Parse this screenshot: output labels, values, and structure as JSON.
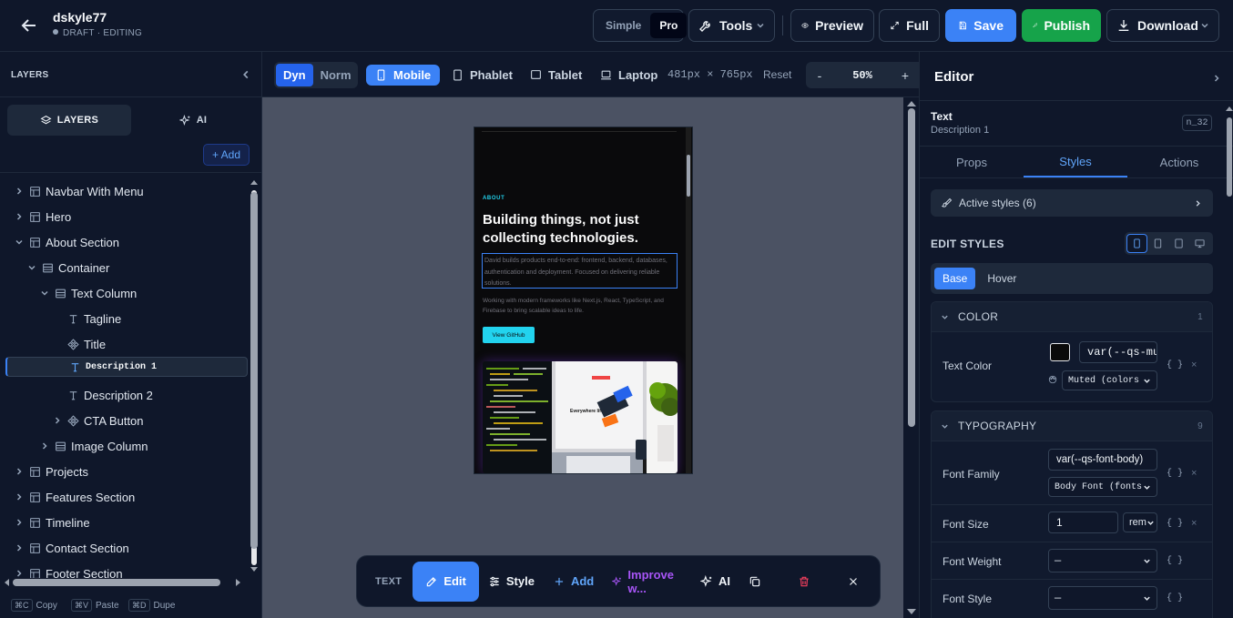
{
  "project": {
    "name": "dskyle77",
    "status": "DRAFT · EDITING"
  },
  "topbar": {
    "modes": [
      "Simple",
      "Pro"
    ],
    "tools_label": "Tools",
    "preview_label": "Preview",
    "full_label": "Full",
    "save_label": "Save",
    "publish_label": "Publish",
    "download_label": "Download"
  },
  "colors": {
    "accent": "#3b82f6",
    "publish": "#16a34a",
    "cyan": "#22d3ee",
    "danger": "#f43f5e"
  },
  "layers_panel": {
    "title": "LAYERS",
    "tabs": [
      "LAYERS",
      "AI"
    ],
    "add_label": "+ Add",
    "tree": [
      {
        "label": "Navbar With Menu",
        "icon": "layout-icon",
        "arrow": "right"
      },
      {
        "label": "Hero",
        "icon": "layout-icon",
        "arrow": "right"
      },
      {
        "label": "About Section",
        "icon": "layout-icon",
        "arrow": "down"
      },
      {
        "label": "Container",
        "icon": "box-icon",
        "arrow": "down"
      },
      {
        "label": "Text Column",
        "icon": "box-icon",
        "arrow": "down"
      },
      {
        "label": "Tagline",
        "icon": "text-icon",
        "arrow": ""
      },
      {
        "label": "Title",
        "icon": "component-icon",
        "arrow": ""
      },
      {
        "label": "Description 1",
        "icon": "text-icon",
        "arrow": "",
        "selected": true
      },
      {
        "label": "Description 2",
        "icon": "text-icon",
        "arrow": ""
      },
      {
        "label": "CTA Button",
        "icon": "component-icon",
        "arrow": "right"
      },
      {
        "label": "Image Column",
        "icon": "box-icon",
        "arrow": "right"
      },
      {
        "label": "Projects",
        "icon": "layout-icon",
        "arrow": "right"
      },
      {
        "label": "Features Section",
        "icon": "layout-icon",
        "arrow": "right"
      },
      {
        "label": "Timeline",
        "icon": "layout-icon",
        "arrow": "right"
      },
      {
        "label": "Contact Section",
        "icon": "layout-icon",
        "arrow": "right"
      },
      {
        "label": "Footer Section",
        "icon": "layout-icon",
        "arrow": "right"
      }
    ],
    "shortcuts": [
      {
        "key": "⌘C",
        "label": "Copy"
      },
      {
        "key": "⌘V",
        "label": "Paste"
      },
      {
        "key": "⌘D",
        "label": "Dupe"
      }
    ]
  },
  "canvas_toolbar": {
    "dyn": "Dyn",
    "norm": "Norm",
    "devices": [
      "Mobile",
      "Phablet",
      "Tablet",
      "Laptop"
    ],
    "dimensions": "481px × 765px",
    "reset": "Reset",
    "zoom_minus": "-",
    "zoom": "50%",
    "zoom_plus": "+"
  },
  "preview": {
    "tagline": "ABOUT",
    "title": "Building things, not just collecting technologies.",
    "description1": "David builds products end-to-end: frontend, backend, databases, authentication and deployment. Focused on delivering reliable solutions.",
    "description2": "Working with modern frameworks like Next.js, React, TypeScript, and Firebase to bring scalable ideas to life.",
    "cta": "View GitHub"
  },
  "floating_bar": {
    "type_label": "TEXT",
    "edit": "Edit",
    "style": "Style",
    "add": "Add",
    "improve": "Improve w...",
    "ai": "AI"
  },
  "editor": {
    "title": "Editor",
    "selected_type": "Text",
    "selected_name": "Description 1",
    "node_id": "n_32",
    "tabs": [
      "Props",
      "Styles",
      "Actions"
    ],
    "active_styles": "Active styles (6)",
    "edit_styles": "EDIT STYLES",
    "states": [
      "Base",
      "Hover"
    ],
    "color_section": {
      "title": "COLOR",
      "count": "1"
    },
    "text_color": {
      "label": "Text Color",
      "value": "var(--qs-mu",
      "preset": "Muted (colors"
    },
    "typography_section": {
      "title": "TYPOGRAPHY",
      "count": "9"
    },
    "font_family": {
      "label": "Font Family",
      "value": "var(--qs-font-body)",
      "preset": "Body Font (fonts"
    },
    "font_size": {
      "label": "Font Size",
      "value": "1",
      "unit": "rem"
    },
    "font_weight": {
      "label": "Font Weight",
      "value": "—"
    },
    "font_style": {
      "label": "Font Style",
      "value": "—"
    },
    "braces": "{ }",
    "clear": "×"
  }
}
